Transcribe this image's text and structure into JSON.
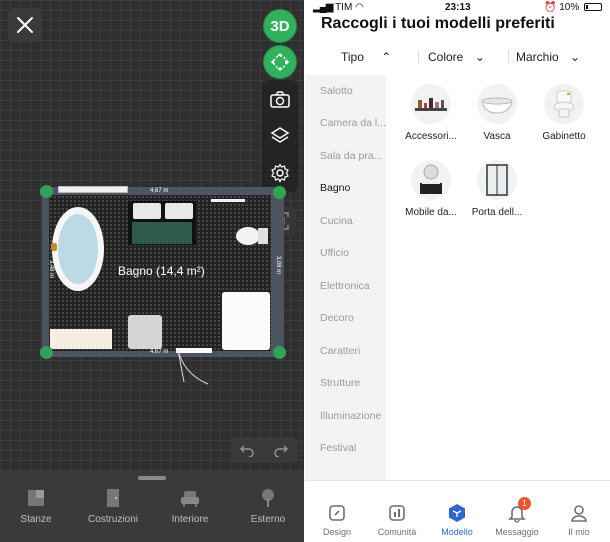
{
  "planner": {
    "view_toggle": "3D",
    "room_label": "Bagno (14,4 m²)",
    "dim_top": "4,67 m",
    "dim_bottom": "4,67 m",
    "dim_left": "3,48 m",
    "dim_right": "3,08 m",
    "bottom_menu": [
      "Stanze",
      "Costruzioni",
      "Interiore",
      "Esterno"
    ]
  },
  "status_bar": {
    "carrier": "TIM",
    "time": "23:13",
    "battery": "10%"
  },
  "catalog": {
    "title": "Raccogli i tuoi modelli preferiti",
    "filters": [
      "Tipo",
      "Colore",
      "Marchio"
    ],
    "categories": [
      "Salotto",
      "Camera da l...",
      "Sala da pra...",
      "Bagno",
      "Cucina",
      "Ufficio",
      "Elettronica",
      "Decoro",
      "Caratteri",
      "Strutture",
      "Illuminazione",
      "Festival"
    ],
    "active_category": "Bagno",
    "products": [
      "Accessori...",
      "Vasca",
      "Gabinetto",
      "Mobile da...",
      "Porta dell..."
    ]
  },
  "tabbar": {
    "items": [
      "Design",
      "Comunità",
      "Modello",
      "Messaggio",
      "Il mio"
    ],
    "active": "Modello",
    "message_badge": "1"
  },
  "colors": {
    "accent_green": "#2fb25a",
    "active_tab_blue": "#2a66d6",
    "badge_orange": "#f0542d"
  }
}
